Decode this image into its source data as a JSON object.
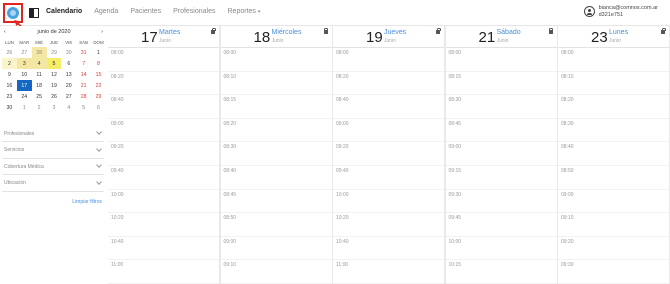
{
  "nav": {
    "items": [
      "Calendario",
      "Agenda",
      "Pacientes",
      "Profesionales",
      "Reportes"
    ],
    "reportes_caret": "▾"
  },
  "user": {
    "email": "bianca@comnos.com.ar",
    "id": "d321e751"
  },
  "mini_calendar": {
    "prev": "‹",
    "month_label": "junio de 2020",
    "next": "›",
    "weekdays": [
      "LUN",
      "MAR",
      "MIÉ",
      "JUE",
      "VIE",
      "SÁB",
      "DOM"
    ],
    "weeks": [
      [
        "26",
        "27",
        "28",
        "29",
        "30",
        "31",
        "1"
      ],
      [
        "2",
        "3",
        "4",
        "5",
        "6",
        "7",
        "8"
      ],
      [
        "9",
        "10",
        "11",
        "12",
        "13",
        "14",
        "15"
      ],
      [
        "16",
        "17",
        "18",
        "19",
        "20",
        "21",
        "22"
      ],
      [
        "23",
        "24",
        "25",
        "26",
        "27",
        "28",
        "29"
      ],
      [
        "30",
        "1",
        "2",
        "3",
        "4",
        "5",
        "6"
      ]
    ],
    "selected": "17"
  },
  "filters": [
    "Profesionales",
    "Servicios",
    "Cobertura Médica",
    "Ubicación"
  ],
  "clear_filters": "Limpiar filtros",
  "days": [
    {
      "num": "17",
      "name": "Martes",
      "month": "Junio",
      "slots": [
        "08:00",
        "08:20",
        "08:40",
        "09:00",
        "09:20",
        "09:40",
        "10:00",
        "10:20",
        "10:40",
        "11:00"
      ]
    },
    {
      "num": "18",
      "name": "Miércoles",
      "month": "Junio",
      "slots": [
        "08:00",
        "08:10",
        "08:15",
        "08:20",
        "08:30",
        "08:40",
        "08:45",
        "08:50",
        "09:00",
        "09:10"
      ]
    },
    {
      "num": "19",
      "name": "Jueves",
      "month": "Junio",
      "slots": [
        "08:00",
        "08:20",
        "08:40",
        "09:00",
        "09:20",
        "09:40",
        "10:00",
        "10:20",
        "10:40",
        "11:00"
      ]
    },
    {
      "num": "21",
      "name": "Sábado",
      "month": "Junio",
      "slots": [
        "08:00",
        "08:15",
        "08:30",
        "08:45",
        "09:00",
        "09:15",
        "09:30",
        "09:45",
        "10:00",
        "10:15"
      ]
    },
    {
      "num": "23",
      "name": "Lunes",
      "month": "Junio",
      "slots": [
        "08:00",
        "08:10",
        "08:20",
        "08:30",
        "08:40",
        "08:50",
        "09:00",
        "09:10",
        "09:20",
        "09:30"
      ]
    }
  ],
  "colors": {
    "accent": "#4a90d9",
    "selected": "#1467c2",
    "highlight_red": "#e0271f"
  }
}
